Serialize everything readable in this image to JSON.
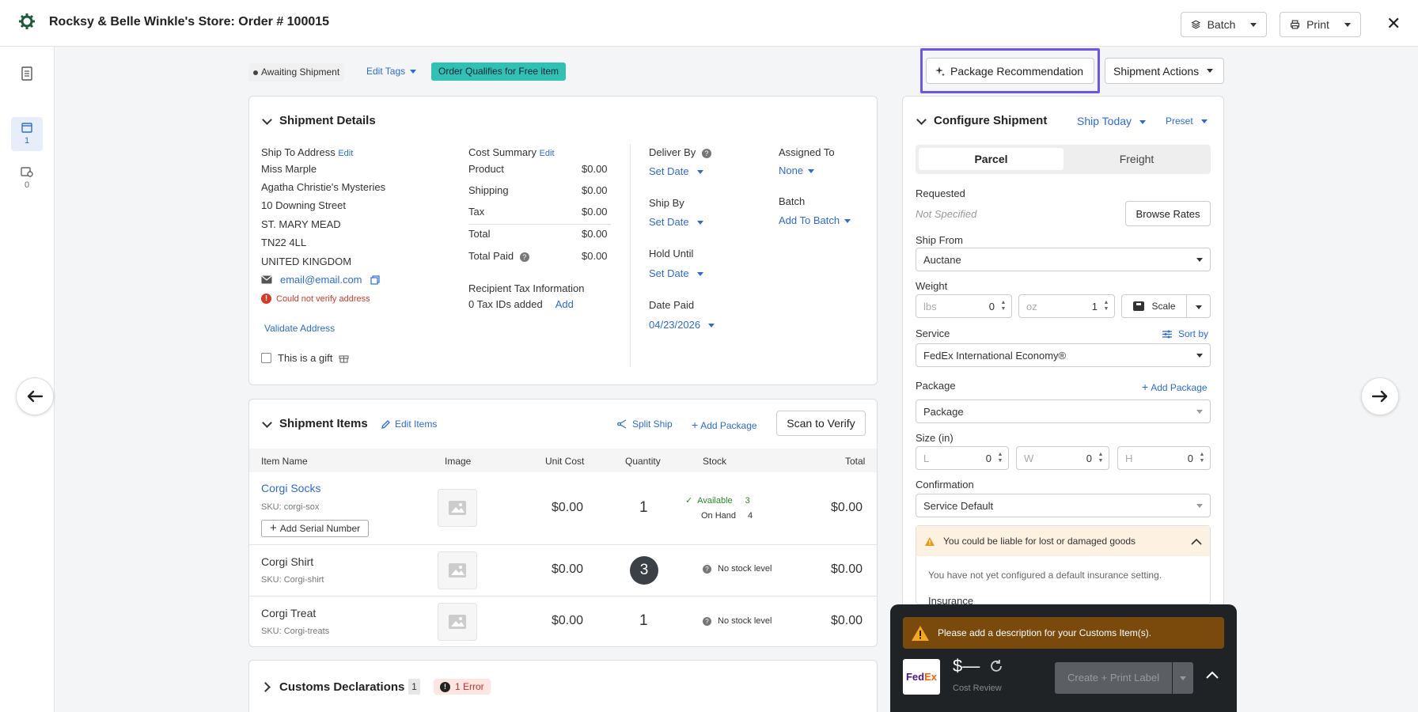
{
  "header": {
    "title": "Rocksy & Belle Winkle's Store:  Order # 100015",
    "batch_label": "Batch",
    "print_label": "Print",
    "close": "✕"
  },
  "rail": {
    "item1_count": "1",
    "item2_count": "0"
  },
  "tags": {
    "status": "Awaiting Shipment",
    "edit_tags": "Edit Tags",
    "free_tag": "Order Qualifies for Free item"
  },
  "actions": {
    "package_recommendation": "Package Recommendation",
    "shipment_actions": "Shipment Actions"
  },
  "shipment_details": {
    "title": "Shipment Details",
    "ship_to_label": "Ship To Address",
    "edit": "Edit",
    "address": [
      "Miss Marple",
      "Agatha Christie's Mysteries",
      "10 Downing Street",
      "ST. MARY MEAD",
      "TN22 4LL",
      "UNITED KINGDOM"
    ],
    "email": "email@email.com",
    "verify_error": "Could not verify address",
    "validate": "Validate Address",
    "gift": "This is a gift",
    "cost_summary_label": "Cost Summary",
    "cost_rows": [
      {
        "label": "Product",
        "value": "$0.00"
      },
      {
        "label": "Shipping",
        "value": "$0.00"
      },
      {
        "label": "Tax",
        "value": "$0.00"
      },
      {
        "label": "Total",
        "value": "$0.00"
      },
      {
        "label": "Total Paid",
        "value": "$0.00"
      }
    ],
    "recipient_tax_label": "Recipient Tax Information",
    "tax_ids": "0 Tax IDs added",
    "add": "Add",
    "deliver_by": "Deliver By",
    "ship_by": "Ship By",
    "hold_until": "Hold Until",
    "date_paid": "Date Paid",
    "set_date": "Set Date",
    "date_paid_value": "04/23/2026",
    "assigned_to": "Assigned To",
    "assigned_value": "None",
    "batch": "Batch",
    "add_to_batch": "Add To Batch"
  },
  "items": {
    "title": "Shipment Items",
    "edit_items": "Edit Items",
    "split_ship": "Split Ship",
    "add_package": "Add Package",
    "scan": "Scan to Verify",
    "columns": [
      "Item Name",
      "Image",
      "Unit Cost",
      "Quantity",
      "Stock",
      "Total"
    ],
    "rows": [
      {
        "name": "Corgi Socks",
        "sku": "SKU: corgi-sox",
        "unit": "$0.00",
        "qty": "1",
        "stock1_label": "Available",
        "stock1_val": "3",
        "stock2_label": "On Hand",
        "stock2_val": "4",
        "total": "$0.00",
        "serial": "Add Serial Number"
      },
      {
        "name": "Corgi Shirt",
        "sku": "SKU: Corgi-shirt",
        "unit": "$0.00",
        "qty": "3",
        "stock": "No stock level",
        "total": "$0.00"
      },
      {
        "name": "Corgi Treat",
        "sku": "SKU: Corgi-treats",
        "unit": "$0.00",
        "qty": "1",
        "stock": "No stock level",
        "total": "$0.00"
      }
    ]
  },
  "customs": {
    "title": "Customs Declarations",
    "count": "1",
    "error": "1 Error"
  },
  "configure": {
    "title": "Configure Shipment",
    "ship_today": "Ship Today",
    "preset": "Preset",
    "tab_parcel": "Parcel",
    "tab_freight": "Freight",
    "requested_label": "Requested",
    "requested_value": "Not Specified",
    "browse_rates": "Browse Rates",
    "ship_from_label": "Ship From",
    "ship_from_value": "Auctane",
    "weight_label": "Weight",
    "lbs_placeholder": "lbs",
    "lbs_value": "0",
    "oz_placeholder": "oz",
    "oz_value": "1",
    "scale": "Scale",
    "service_label": "Service",
    "sort_by": "Sort by",
    "service_value": "FedEx International Economy®",
    "package_label": "Package",
    "add_package": "Add Package",
    "package_value": "Package",
    "size_label": "Size (in)",
    "l": "L",
    "w": "W",
    "h": "H",
    "dim_value": "0",
    "confirmation_label": "Confirmation",
    "confirmation_value": "Service Default",
    "liability_warning": "You could be liable for lost or damaged goods",
    "insurance_note": "You have not yet configured a default insurance setting.",
    "insurance_label": "Insurance"
  },
  "bottom": {
    "customs_warning": "Please add a description for your Customs Item(s).",
    "carrier": "FedEx",
    "price": "$—",
    "cost_review": "Cost Review",
    "create_label": "Create + Print Label"
  }
}
